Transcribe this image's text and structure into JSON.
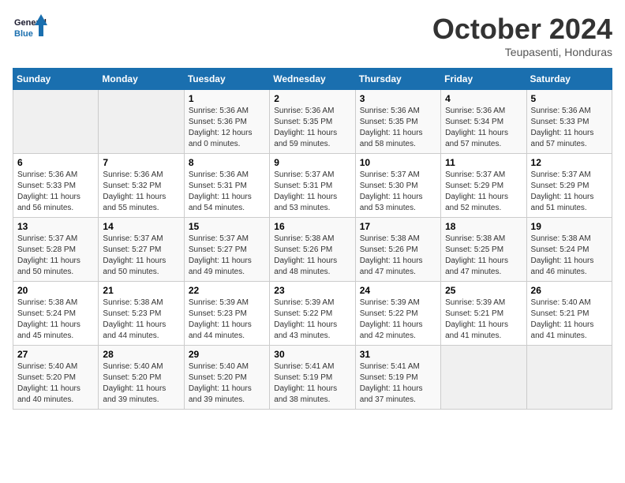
{
  "app": {
    "logo_line1": "General",
    "logo_line2": "Blue"
  },
  "header": {
    "title": "October 2024",
    "location": "Teupasenti, Honduras"
  },
  "weekdays": [
    "Sunday",
    "Monday",
    "Tuesday",
    "Wednesday",
    "Thursday",
    "Friday",
    "Saturday"
  ],
  "weeks": [
    [
      {
        "day": "",
        "sunrise": "",
        "sunset": "",
        "daylight": ""
      },
      {
        "day": "",
        "sunrise": "",
        "sunset": "",
        "daylight": ""
      },
      {
        "day": "1",
        "sunrise": "Sunrise: 5:36 AM",
        "sunset": "Sunset: 5:36 PM",
        "daylight": "Daylight: 12 hours and 0 minutes."
      },
      {
        "day": "2",
        "sunrise": "Sunrise: 5:36 AM",
        "sunset": "Sunset: 5:35 PM",
        "daylight": "Daylight: 11 hours and 59 minutes."
      },
      {
        "day": "3",
        "sunrise": "Sunrise: 5:36 AM",
        "sunset": "Sunset: 5:35 PM",
        "daylight": "Daylight: 11 hours and 58 minutes."
      },
      {
        "day": "4",
        "sunrise": "Sunrise: 5:36 AM",
        "sunset": "Sunset: 5:34 PM",
        "daylight": "Daylight: 11 hours and 57 minutes."
      },
      {
        "day": "5",
        "sunrise": "Sunrise: 5:36 AM",
        "sunset": "Sunset: 5:33 PM",
        "daylight": "Daylight: 11 hours and 57 minutes."
      }
    ],
    [
      {
        "day": "6",
        "sunrise": "Sunrise: 5:36 AM",
        "sunset": "Sunset: 5:33 PM",
        "daylight": "Daylight: 11 hours and 56 minutes."
      },
      {
        "day": "7",
        "sunrise": "Sunrise: 5:36 AM",
        "sunset": "Sunset: 5:32 PM",
        "daylight": "Daylight: 11 hours and 55 minutes."
      },
      {
        "day": "8",
        "sunrise": "Sunrise: 5:36 AM",
        "sunset": "Sunset: 5:31 PM",
        "daylight": "Daylight: 11 hours and 54 minutes."
      },
      {
        "day": "9",
        "sunrise": "Sunrise: 5:37 AM",
        "sunset": "Sunset: 5:31 PM",
        "daylight": "Daylight: 11 hours and 53 minutes."
      },
      {
        "day": "10",
        "sunrise": "Sunrise: 5:37 AM",
        "sunset": "Sunset: 5:30 PM",
        "daylight": "Daylight: 11 hours and 53 minutes."
      },
      {
        "day": "11",
        "sunrise": "Sunrise: 5:37 AM",
        "sunset": "Sunset: 5:29 PM",
        "daylight": "Daylight: 11 hours and 52 minutes."
      },
      {
        "day": "12",
        "sunrise": "Sunrise: 5:37 AM",
        "sunset": "Sunset: 5:29 PM",
        "daylight": "Daylight: 11 hours and 51 minutes."
      }
    ],
    [
      {
        "day": "13",
        "sunrise": "Sunrise: 5:37 AM",
        "sunset": "Sunset: 5:28 PM",
        "daylight": "Daylight: 11 hours and 50 minutes."
      },
      {
        "day": "14",
        "sunrise": "Sunrise: 5:37 AM",
        "sunset": "Sunset: 5:27 PM",
        "daylight": "Daylight: 11 hours and 50 minutes."
      },
      {
        "day": "15",
        "sunrise": "Sunrise: 5:37 AM",
        "sunset": "Sunset: 5:27 PM",
        "daylight": "Daylight: 11 hours and 49 minutes."
      },
      {
        "day": "16",
        "sunrise": "Sunrise: 5:38 AM",
        "sunset": "Sunset: 5:26 PM",
        "daylight": "Daylight: 11 hours and 48 minutes."
      },
      {
        "day": "17",
        "sunrise": "Sunrise: 5:38 AM",
        "sunset": "Sunset: 5:26 PM",
        "daylight": "Daylight: 11 hours and 47 minutes."
      },
      {
        "day": "18",
        "sunrise": "Sunrise: 5:38 AM",
        "sunset": "Sunset: 5:25 PM",
        "daylight": "Daylight: 11 hours and 47 minutes."
      },
      {
        "day": "19",
        "sunrise": "Sunrise: 5:38 AM",
        "sunset": "Sunset: 5:24 PM",
        "daylight": "Daylight: 11 hours and 46 minutes."
      }
    ],
    [
      {
        "day": "20",
        "sunrise": "Sunrise: 5:38 AM",
        "sunset": "Sunset: 5:24 PM",
        "daylight": "Daylight: 11 hours and 45 minutes."
      },
      {
        "day": "21",
        "sunrise": "Sunrise: 5:38 AM",
        "sunset": "Sunset: 5:23 PM",
        "daylight": "Daylight: 11 hours and 44 minutes."
      },
      {
        "day": "22",
        "sunrise": "Sunrise: 5:39 AM",
        "sunset": "Sunset: 5:23 PM",
        "daylight": "Daylight: 11 hours and 44 minutes."
      },
      {
        "day": "23",
        "sunrise": "Sunrise: 5:39 AM",
        "sunset": "Sunset: 5:22 PM",
        "daylight": "Daylight: 11 hours and 43 minutes."
      },
      {
        "day": "24",
        "sunrise": "Sunrise: 5:39 AM",
        "sunset": "Sunset: 5:22 PM",
        "daylight": "Daylight: 11 hours and 42 minutes."
      },
      {
        "day": "25",
        "sunrise": "Sunrise: 5:39 AM",
        "sunset": "Sunset: 5:21 PM",
        "daylight": "Daylight: 11 hours and 41 minutes."
      },
      {
        "day": "26",
        "sunrise": "Sunrise: 5:40 AM",
        "sunset": "Sunset: 5:21 PM",
        "daylight": "Daylight: 11 hours and 41 minutes."
      }
    ],
    [
      {
        "day": "27",
        "sunrise": "Sunrise: 5:40 AM",
        "sunset": "Sunset: 5:20 PM",
        "daylight": "Daylight: 11 hours and 40 minutes."
      },
      {
        "day": "28",
        "sunrise": "Sunrise: 5:40 AM",
        "sunset": "Sunset: 5:20 PM",
        "daylight": "Daylight: 11 hours and 39 minutes."
      },
      {
        "day": "29",
        "sunrise": "Sunrise: 5:40 AM",
        "sunset": "Sunset: 5:20 PM",
        "daylight": "Daylight: 11 hours and 39 minutes."
      },
      {
        "day": "30",
        "sunrise": "Sunrise: 5:41 AM",
        "sunset": "Sunset: 5:19 PM",
        "daylight": "Daylight: 11 hours and 38 minutes."
      },
      {
        "day": "31",
        "sunrise": "Sunrise: 5:41 AM",
        "sunset": "Sunset: 5:19 PM",
        "daylight": "Daylight: 11 hours and 37 minutes."
      },
      {
        "day": "",
        "sunrise": "",
        "sunset": "",
        "daylight": ""
      },
      {
        "day": "",
        "sunrise": "",
        "sunset": "",
        "daylight": ""
      }
    ]
  ]
}
